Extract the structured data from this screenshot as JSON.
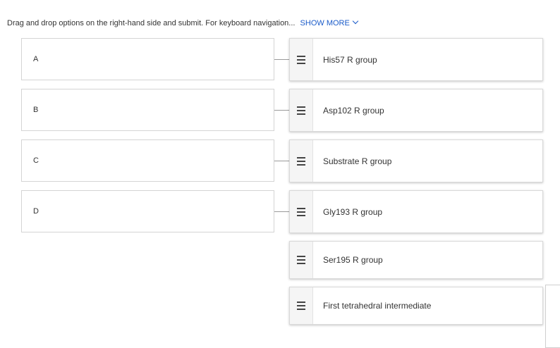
{
  "instructions": {
    "text": "Drag and drop options on the right-hand side and submit. For keyboard navigation...",
    "show_more": "SHOW MORE"
  },
  "targets": [
    {
      "label": "A"
    },
    {
      "label": "B"
    },
    {
      "label": "C"
    },
    {
      "label": "D"
    }
  ],
  "options": [
    {
      "label": "His57 R group",
      "icon": "drag-handle-icon"
    },
    {
      "label": "Asp102 R group",
      "icon": "drag-handle-icon"
    },
    {
      "label": "Substrate R group",
      "icon": "drag-handle-icon"
    },
    {
      "label": "Gly193 R group",
      "icon": "drag-handle-icon"
    },
    {
      "label": "Ser195 R group",
      "icon": "drag-handle-icon"
    },
    {
      "label": "First tetrahedral intermediate",
      "icon": "drag-handle-icon"
    }
  ],
  "colors": {
    "link": "#1a5bc9",
    "border": "#d4d4d4",
    "handle_bg": "#f5f5f5"
  }
}
